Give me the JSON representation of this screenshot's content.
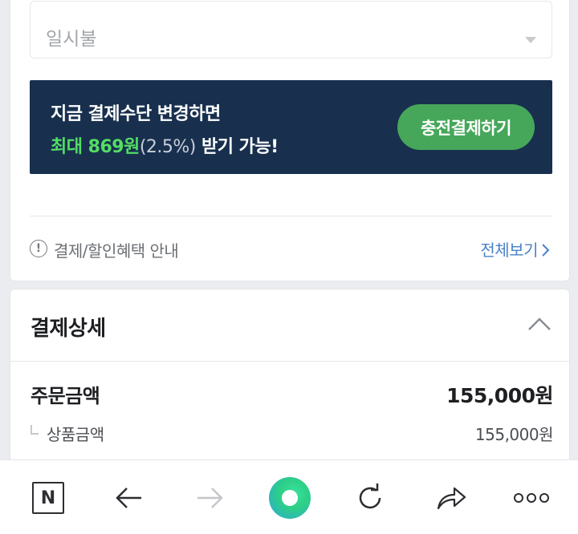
{
  "payment_plan": {
    "selected": "일시불"
  },
  "promo": {
    "line1": "지금 결제수단 변경하면",
    "line2_prefix": "최대 869원",
    "line2_pct": "(2.5%)",
    "line2_suffix": " 받기 가능!",
    "button_label": "충전결제하기",
    "bg_color": "#18304e",
    "button_color": "#46a75a",
    "highlight_color": "#53dd65"
  },
  "benefit_info": {
    "icon_glyph": "!",
    "label": "결제/할인혜택 안내",
    "link_label": "전체보기"
  },
  "payment_detail": {
    "title": "결제상세",
    "order_amount_label": "주문금액",
    "order_amount_value": "155,000원",
    "product_amount_label": "상품금액",
    "product_amount_value": "155,000원"
  },
  "toolbar": {
    "items": [
      {
        "name": "naver-home",
        "glyph": "N"
      },
      {
        "name": "back"
      },
      {
        "name": "forward"
      },
      {
        "name": "green-dot"
      },
      {
        "name": "refresh"
      },
      {
        "name": "share"
      },
      {
        "name": "more"
      }
    ]
  }
}
